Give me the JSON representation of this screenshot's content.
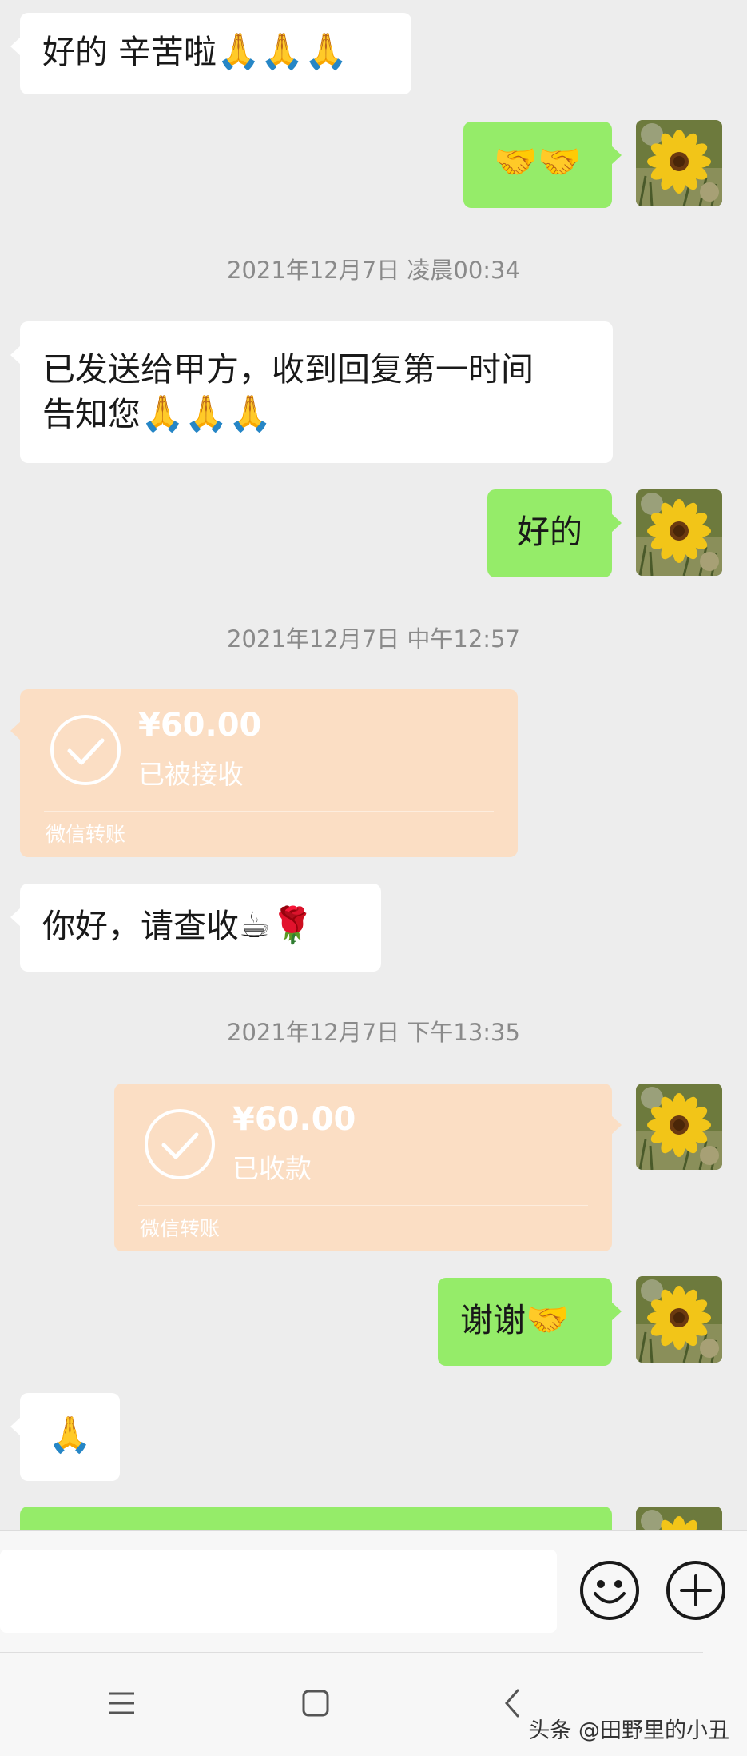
{
  "messages": [
    {
      "text": "好的 辛苦啦",
      "emoji": "🙏🙏🙏"
    },
    {
      "emoji": "🤝🤝"
    },
    {
      "text_line1": "已发送给甲方，收到回复第一时间",
      "text_line2": "告知您",
      "emoji": "🙏🙏🙏"
    },
    {
      "text": "好的"
    },
    {
      "text": "你好，请查收",
      "emoji": "☕🌹"
    },
    {
      "text": "谢谢",
      "emoji": "🤝"
    },
    {
      "emoji": "🙏"
    }
  ],
  "timestamps": [
    "2021年12月7日 凌晨00:34",
    "2021年12月7日 中午12:57",
    "2021年12月7日 下午13:35"
  ],
  "transfers": [
    {
      "amount": "¥60.00",
      "status": "已被接收",
      "footer": "微信转账"
    },
    {
      "amount": "¥60.00",
      "status": "已收款",
      "footer": "微信转账"
    }
  ],
  "input": {
    "placeholder": ""
  },
  "watermark": "头条 @田野里的小丑",
  "colors": {
    "self_bubble": "#95ec69",
    "other_bubble": "#ffffff",
    "transfer": "#fbdec4",
    "background": "#ededed"
  },
  "icons": [
    "emoji-face-icon",
    "plus-icon",
    "menu-icon",
    "home-icon",
    "back-icon",
    "check-icon",
    "sunflower-avatar"
  ]
}
